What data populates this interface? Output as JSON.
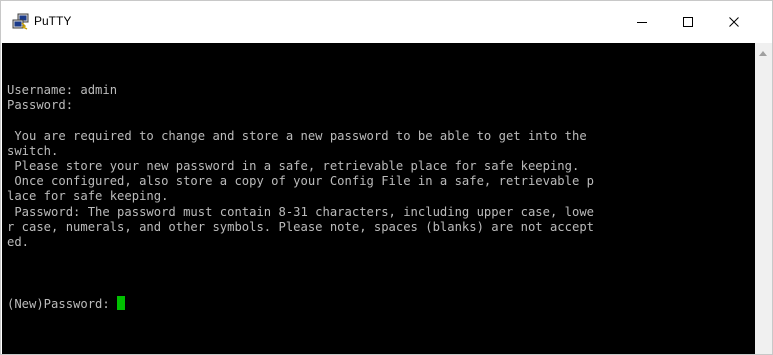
{
  "window": {
    "title": "PuTTY",
    "app_icon": "putty-icon",
    "controls": [
      "minimize-icon",
      "maximize-icon",
      "close-icon"
    ]
  },
  "terminal": {
    "lines": [
      "Username: admin",
      "Password:",
      "",
      " You are required to change and store a new password to be able to get into the",
      "switch.",
      " Please store your new password in a safe, retrievable place for safe keeping.",
      " Once configured, also store a copy of your Config File in a safe, retrievable p",
      "lace for safe keeping.",
      " Password: The password must contain 8-31 characters, including upper case, lowe",
      "r case, numerals, and other symbols. Please note, spaces (blanks) are not accept",
      "ed.",
      "",
      "",
      "",
      "(New)Password: "
    ],
    "text_color": "#bbbbbb",
    "background_color": "#000000",
    "cursor_color": "#00c000"
  }
}
